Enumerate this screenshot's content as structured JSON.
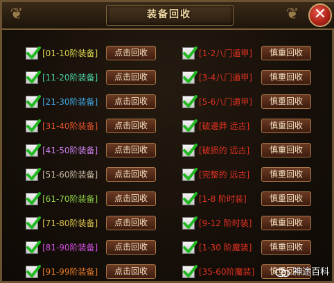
{
  "title": "装备回收",
  "close_label": "✕",
  "left_button_label": "点击回收",
  "right_button_label": "慎重回收",
  "left_items": [
    {
      "label": "[01-10阶装备]",
      "color": "#d8d24a"
    },
    {
      "label": "[11-20阶装备]",
      "color": "#4ad2a6"
    },
    {
      "label": "[21-30阶装备]",
      "color": "#41a8e6"
    },
    {
      "label": "[31-40阶装备]",
      "color": "#e2512a"
    },
    {
      "label": "[41-50阶装备]",
      "color": "#c77ce8"
    },
    {
      "label": "[51-60阶装备]",
      "color": "#c8b8a0"
    },
    {
      "label": "[61-70阶装备]",
      "color": "#8fd24a"
    },
    {
      "label": "[71-80阶装备]",
      "color": "#d8c24a"
    },
    {
      "label": "[81-90阶装备]",
      "color": "#cf4fe0"
    },
    {
      "label": "[91-99阶装备]",
      "color": "#e0782a"
    }
  ],
  "right_items": [
    {
      "label": "[1-2八门遁甲]",
      "color": "#e23222"
    },
    {
      "label": "[3-4八门遁甲]",
      "color": "#e23222"
    },
    {
      "label": "[5-6八门遁甲]",
      "color": "#e23222"
    },
    {
      "label": "[破邊莽 远古]",
      "color": "#e23222"
    },
    {
      "label": "[破损的 远古]",
      "color": "#e23222"
    },
    {
      "label": "[完整的 远古]",
      "color": "#e23222"
    },
    {
      "label": "[1-8  阶时装]",
      "color": "#e23222"
    },
    {
      "label": "[9-12 阶时装]",
      "color": "#e23222"
    },
    {
      "label": "[1-30 阶魔装]",
      "color": "#e23222"
    },
    {
      "label": "[35-60阶魔装]",
      "color": "#e23222"
    }
  ],
  "watermark": "神途百科"
}
